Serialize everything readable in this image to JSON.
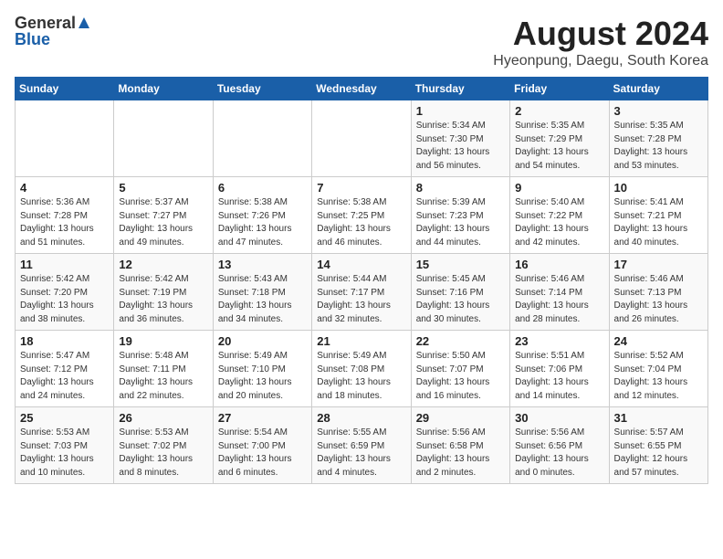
{
  "header": {
    "logo_general": "General",
    "logo_blue": "Blue",
    "month_title": "August 2024",
    "location": "Hyeonpung, Daegu, South Korea"
  },
  "weekdays": [
    "Sunday",
    "Monday",
    "Tuesday",
    "Wednesday",
    "Thursday",
    "Friday",
    "Saturday"
  ],
  "weeks": [
    [
      {
        "day": "",
        "info": ""
      },
      {
        "day": "",
        "info": ""
      },
      {
        "day": "",
        "info": ""
      },
      {
        "day": "",
        "info": ""
      },
      {
        "day": "1",
        "info": "Sunrise: 5:34 AM\nSunset: 7:30 PM\nDaylight: 13 hours\nand 56 minutes."
      },
      {
        "day": "2",
        "info": "Sunrise: 5:35 AM\nSunset: 7:29 PM\nDaylight: 13 hours\nand 54 minutes."
      },
      {
        "day": "3",
        "info": "Sunrise: 5:35 AM\nSunset: 7:28 PM\nDaylight: 13 hours\nand 53 minutes."
      }
    ],
    [
      {
        "day": "4",
        "info": "Sunrise: 5:36 AM\nSunset: 7:28 PM\nDaylight: 13 hours\nand 51 minutes."
      },
      {
        "day": "5",
        "info": "Sunrise: 5:37 AM\nSunset: 7:27 PM\nDaylight: 13 hours\nand 49 minutes."
      },
      {
        "day": "6",
        "info": "Sunrise: 5:38 AM\nSunset: 7:26 PM\nDaylight: 13 hours\nand 47 minutes."
      },
      {
        "day": "7",
        "info": "Sunrise: 5:38 AM\nSunset: 7:25 PM\nDaylight: 13 hours\nand 46 minutes."
      },
      {
        "day": "8",
        "info": "Sunrise: 5:39 AM\nSunset: 7:23 PM\nDaylight: 13 hours\nand 44 minutes."
      },
      {
        "day": "9",
        "info": "Sunrise: 5:40 AM\nSunset: 7:22 PM\nDaylight: 13 hours\nand 42 minutes."
      },
      {
        "day": "10",
        "info": "Sunrise: 5:41 AM\nSunset: 7:21 PM\nDaylight: 13 hours\nand 40 minutes."
      }
    ],
    [
      {
        "day": "11",
        "info": "Sunrise: 5:42 AM\nSunset: 7:20 PM\nDaylight: 13 hours\nand 38 minutes."
      },
      {
        "day": "12",
        "info": "Sunrise: 5:42 AM\nSunset: 7:19 PM\nDaylight: 13 hours\nand 36 minutes."
      },
      {
        "day": "13",
        "info": "Sunrise: 5:43 AM\nSunset: 7:18 PM\nDaylight: 13 hours\nand 34 minutes."
      },
      {
        "day": "14",
        "info": "Sunrise: 5:44 AM\nSunset: 7:17 PM\nDaylight: 13 hours\nand 32 minutes."
      },
      {
        "day": "15",
        "info": "Sunrise: 5:45 AM\nSunset: 7:16 PM\nDaylight: 13 hours\nand 30 minutes."
      },
      {
        "day": "16",
        "info": "Sunrise: 5:46 AM\nSunset: 7:14 PM\nDaylight: 13 hours\nand 28 minutes."
      },
      {
        "day": "17",
        "info": "Sunrise: 5:46 AM\nSunset: 7:13 PM\nDaylight: 13 hours\nand 26 minutes."
      }
    ],
    [
      {
        "day": "18",
        "info": "Sunrise: 5:47 AM\nSunset: 7:12 PM\nDaylight: 13 hours\nand 24 minutes."
      },
      {
        "day": "19",
        "info": "Sunrise: 5:48 AM\nSunset: 7:11 PM\nDaylight: 13 hours\nand 22 minutes."
      },
      {
        "day": "20",
        "info": "Sunrise: 5:49 AM\nSunset: 7:10 PM\nDaylight: 13 hours\nand 20 minutes."
      },
      {
        "day": "21",
        "info": "Sunrise: 5:49 AM\nSunset: 7:08 PM\nDaylight: 13 hours\nand 18 minutes."
      },
      {
        "day": "22",
        "info": "Sunrise: 5:50 AM\nSunset: 7:07 PM\nDaylight: 13 hours\nand 16 minutes."
      },
      {
        "day": "23",
        "info": "Sunrise: 5:51 AM\nSunset: 7:06 PM\nDaylight: 13 hours\nand 14 minutes."
      },
      {
        "day": "24",
        "info": "Sunrise: 5:52 AM\nSunset: 7:04 PM\nDaylight: 13 hours\nand 12 minutes."
      }
    ],
    [
      {
        "day": "25",
        "info": "Sunrise: 5:53 AM\nSunset: 7:03 PM\nDaylight: 13 hours\nand 10 minutes."
      },
      {
        "day": "26",
        "info": "Sunrise: 5:53 AM\nSunset: 7:02 PM\nDaylight: 13 hours\nand 8 minutes."
      },
      {
        "day": "27",
        "info": "Sunrise: 5:54 AM\nSunset: 7:00 PM\nDaylight: 13 hours\nand 6 minutes."
      },
      {
        "day": "28",
        "info": "Sunrise: 5:55 AM\nSunset: 6:59 PM\nDaylight: 13 hours\nand 4 minutes."
      },
      {
        "day": "29",
        "info": "Sunrise: 5:56 AM\nSunset: 6:58 PM\nDaylight: 13 hours\nand 2 minutes."
      },
      {
        "day": "30",
        "info": "Sunrise: 5:56 AM\nSunset: 6:56 PM\nDaylight: 13 hours\nand 0 minutes."
      },
      {
        "day": "31",
        "info": "Sunrise: 5:57 AM\nSunset: 6:55 PM\nDaylight: 12 hours\nand 57 minutes."
      }
    ]
  ]
}
